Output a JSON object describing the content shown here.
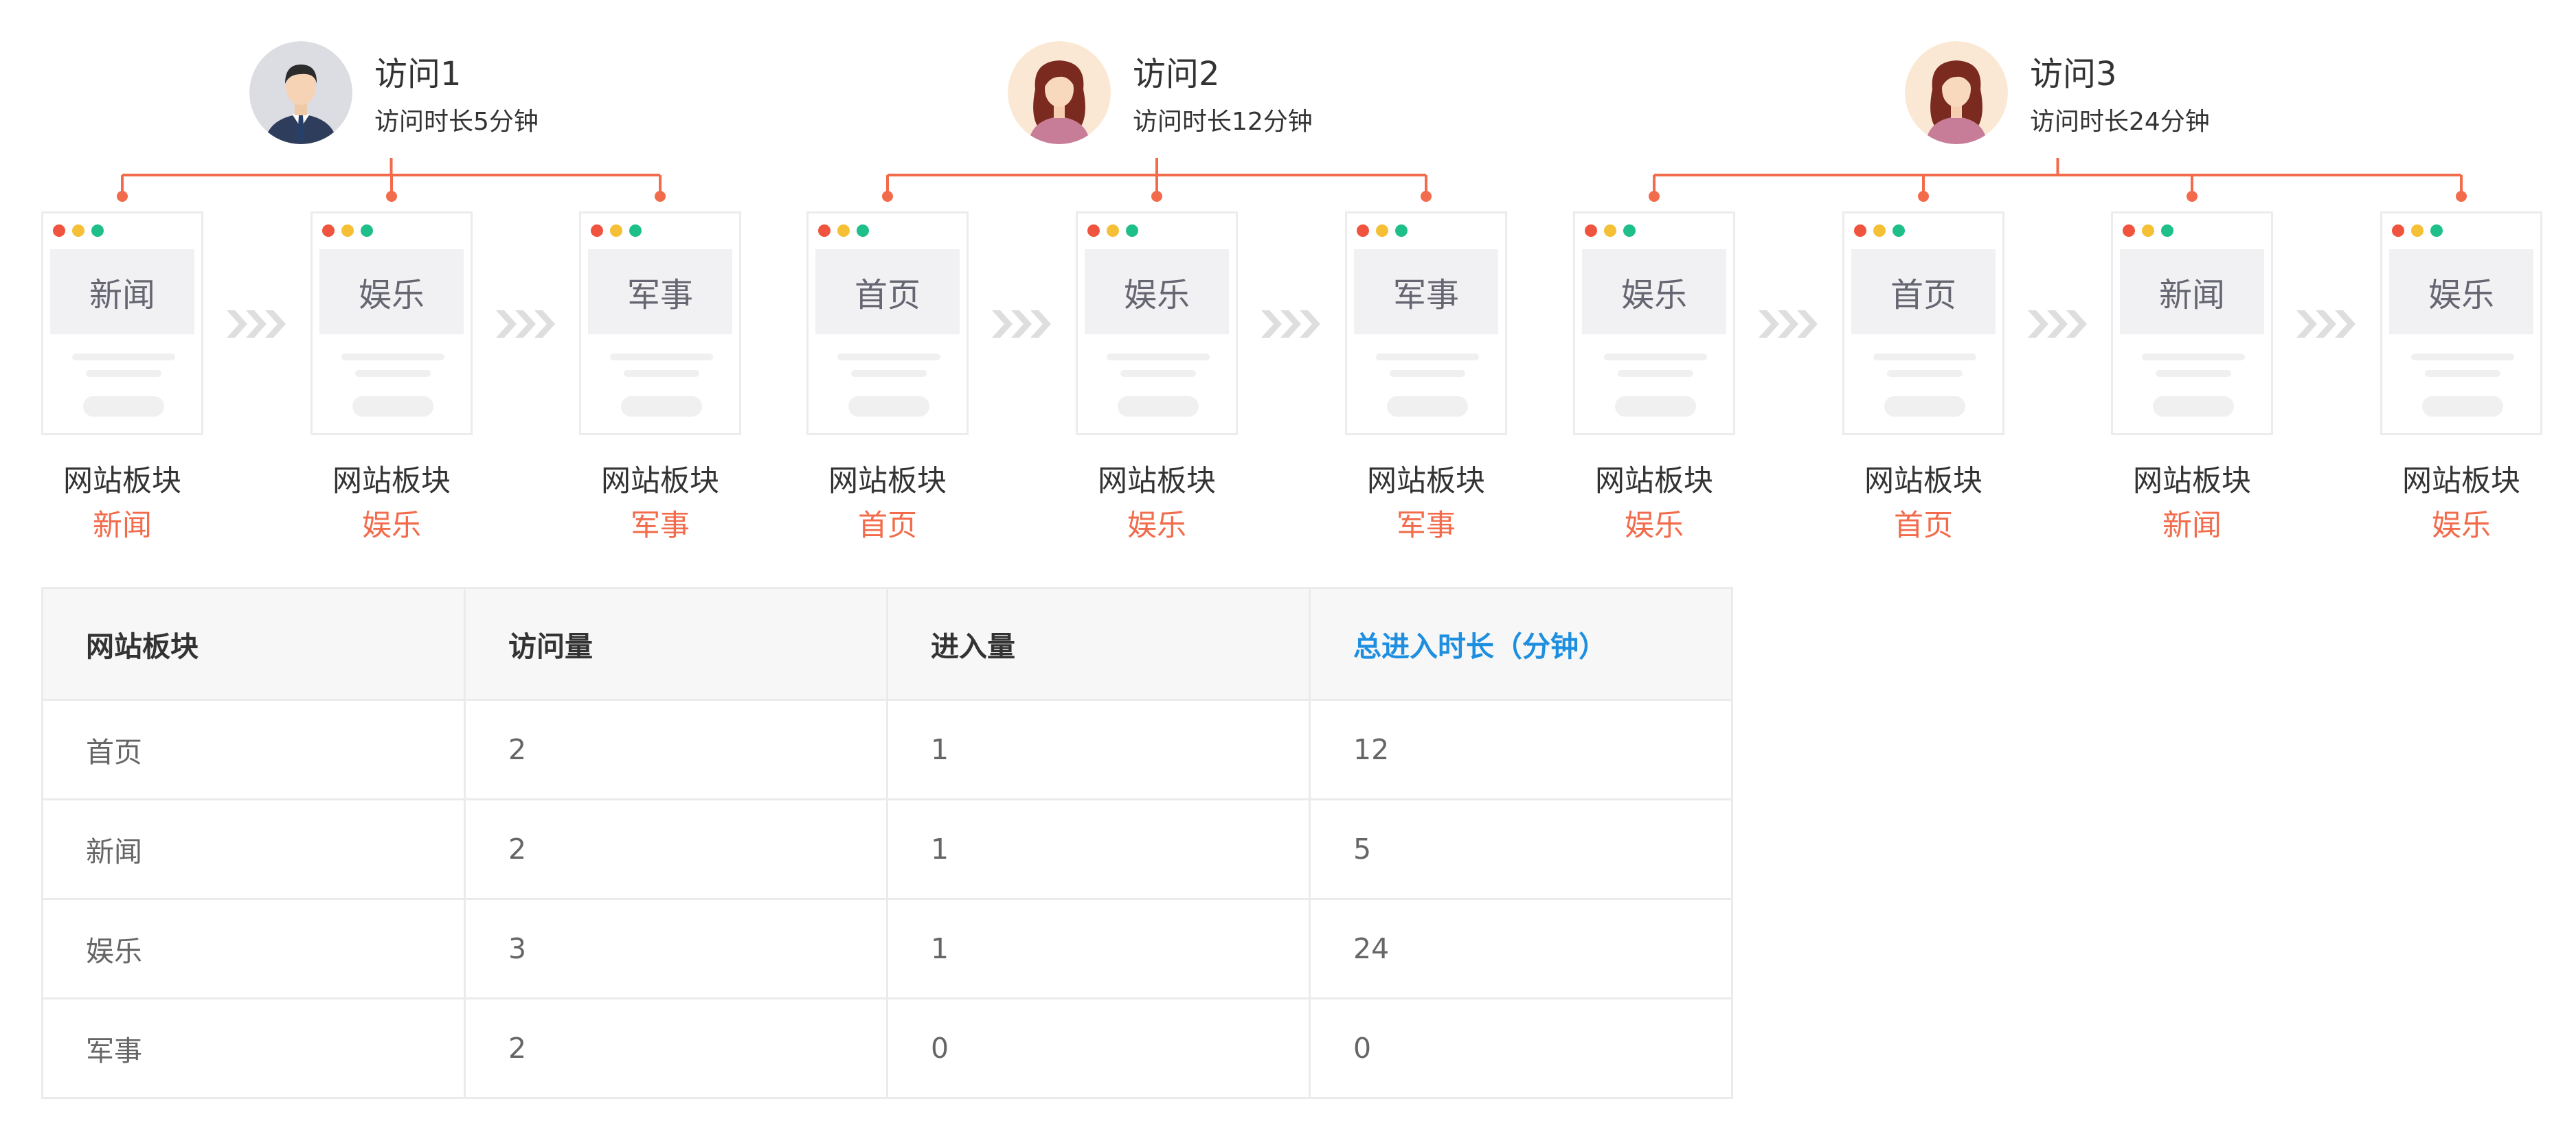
{
  "colors": {
    "accent": "#f26b4b",
    "header_highlight": "#1e8fe0",
    "dot_red": "#f0533e",
    "dot_yellow": "#f5c035",
    "dot_green": "#1fbf89"
  },
  "visits": [
    {
      "title": "访问1",
      "duration": "访问时长5分钟",
      "avatar_icon": "male-user-avatar",
      "pages": [
        {
          "banner": "新闻",
          "label": "网站板块",
          "value": "新闻"
        },
        {
          "banner": "娱乐",
          "label": "网站板块",
          "value": "娱乐"
        },
        {
          "banner": "军事",
          "label": "网站板块",
          "value": "军事"
        }
      ]
    },
    {
      "title": "访问2",
      "duration": "访问时长12分钟",
      "avatar_icon": "female-user-avatar",
      "pages": [
        {
          "banner": "首页",
          "label": "网站板块",
          "value": "首页"
        },
        {
          "banner": "娱乐",
          "label": "网站板块",
          "value": "娱乐"
        },
        {
          "banner": "军事",
          "label": "网站板块",
          "value": "军事"
        }
      ]
    },
    {
      "title": "访问3",
      "duration": "访问时长24分钟",
      "avatar_icon": "female-user-avatar",
      "pages": [
        {
          "banner": "娱乐",
          "label": "网站板块",
          "value": "娱乐"
        },
        {
          "banner": "首页",
          "label": "网站板块",
          "value": "首页"
        },
        {
          "banner": "新闻",
          "label": "网站板块",
          "value": "新闻"
        },
        {
          "banner": "娱乐",
          "label": "网站板块",
          "value": "娱乐"
        }
      ]
    }
  ],
  "table": {
    "headers": [
      "网站板块",
      "访问量",
      "进入量",
      "总进入时长（分钟）"
    ],
    "rows": [
      [
        "首页",
        "2",
        "1",
        "12"
      ],
      [
        "新闻",
        "2",
        "1",
        "5"
      ],
      [
        "娱乐",
        "3",
        "1",
        "24"
      ],
      [
        "军事",
        "2",
        "0",
        "0"
      ]
    ]
  }
}
